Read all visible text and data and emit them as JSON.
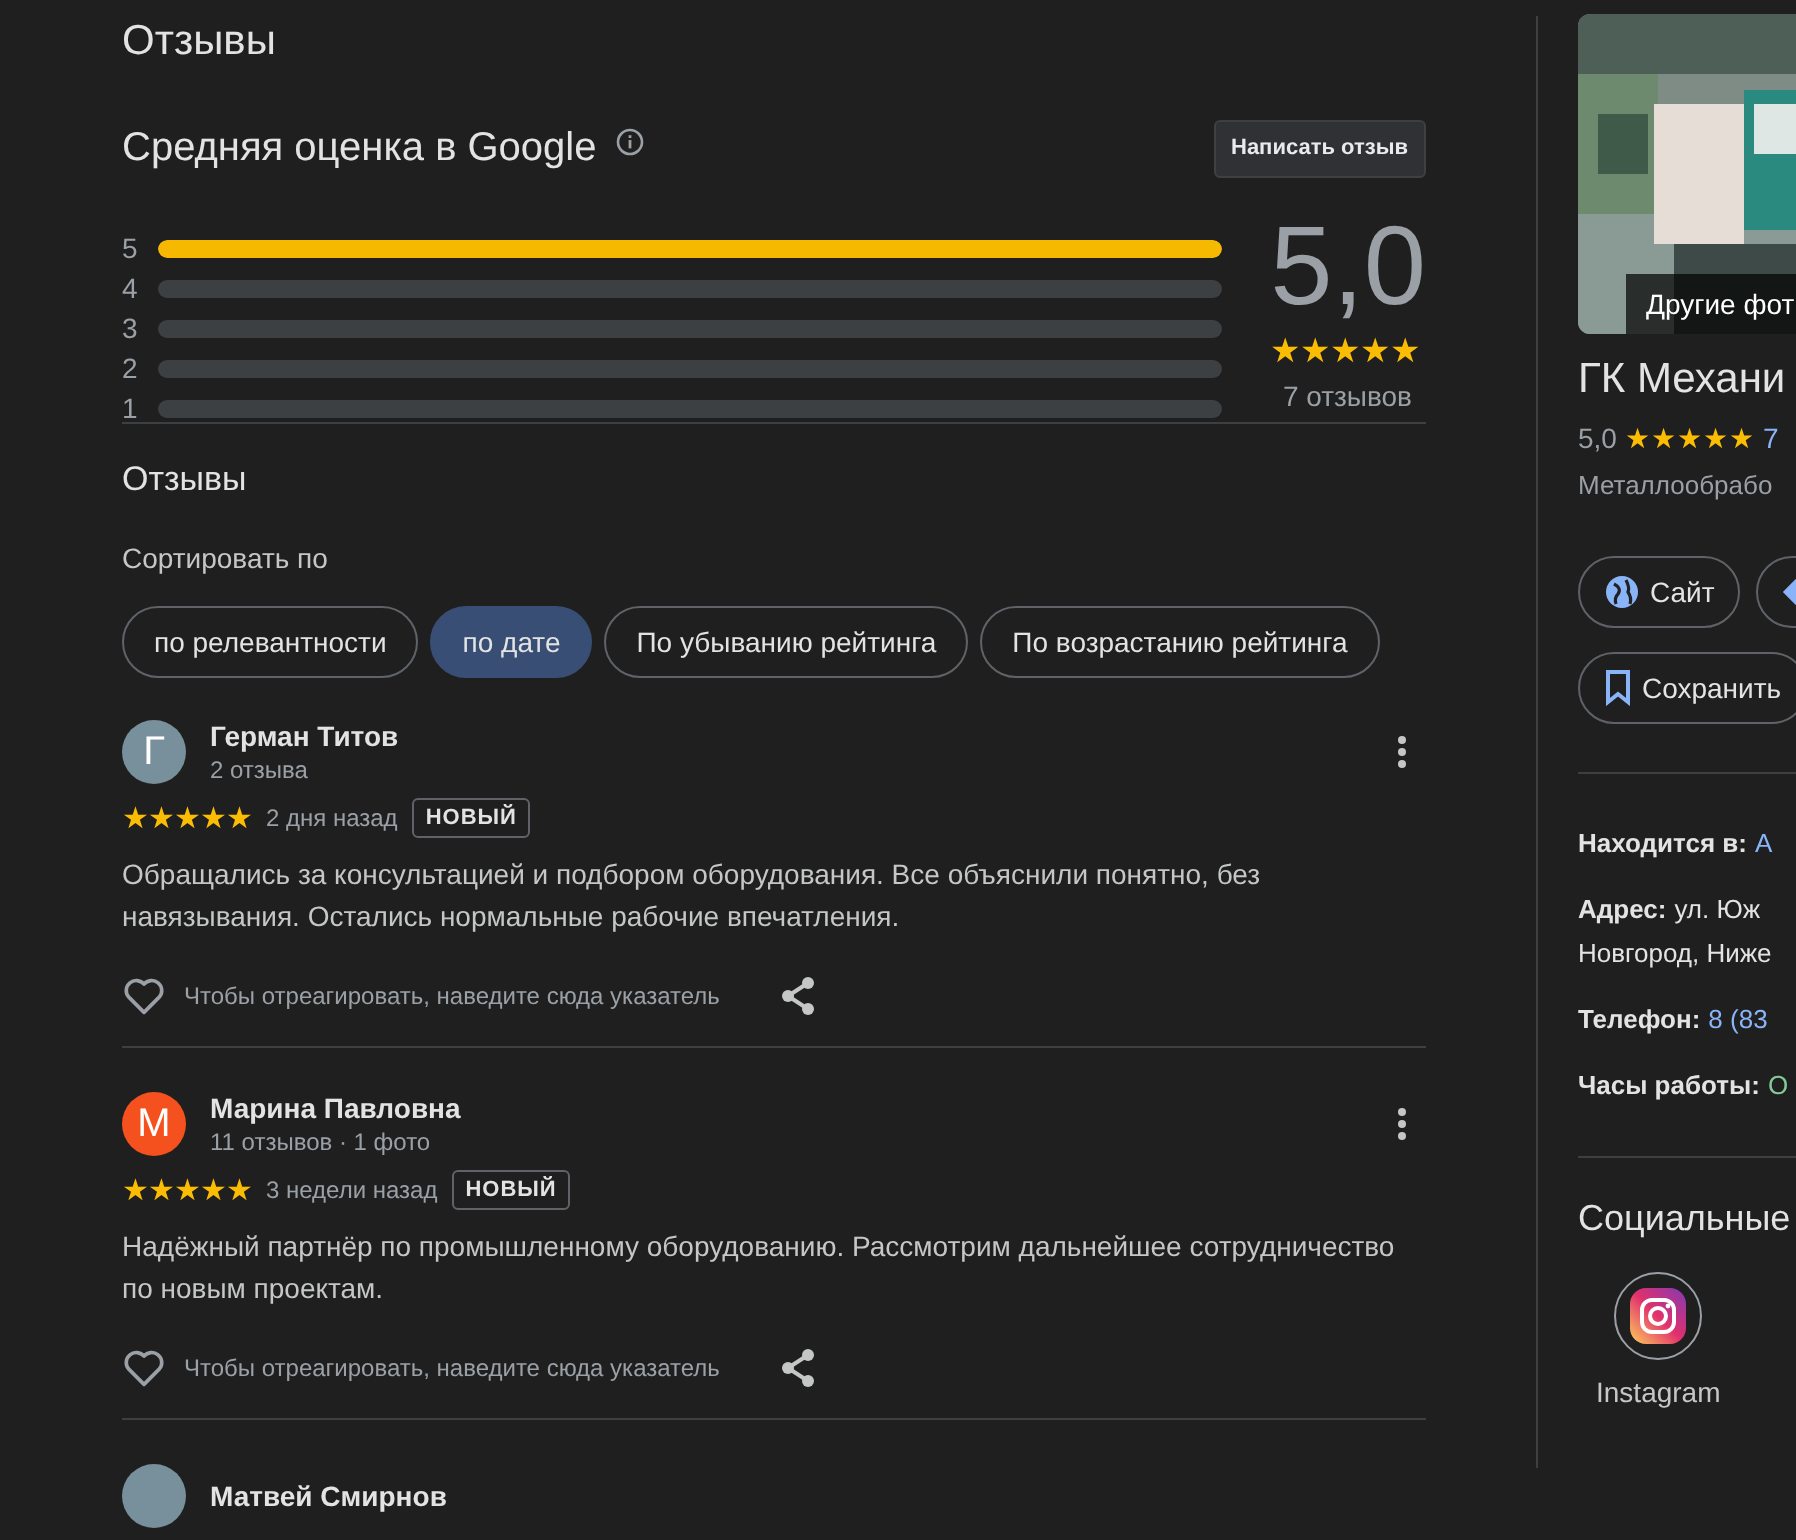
{
  "reviews_heading": "Отзывы",
  "rating_summary": {
    "title": "Средняя оценка в Google",
    "write_button": "Написать отзыв",
    "average": "5,0",
    "stars": 5,
    "count": "7 отзывов",
    "bars": [
      {
        "label": "5",
        "level": 1
      },
      {
        "label": "4",
        "level": 0
      },
      {
        "label": "3",
        "level": 0
      },
      {
        "label": "2",
        "level": 0
      },
      {
        "label": "1",
        "level": 0
      }
    ]
  },
  "reviews_subheading": "Отзывы",
  "sort_label": "Сортировать по",
  "sort_chips": [
    {
      "label": "по релевантности",
      "selected": false
    },
    {
      "label": "по дате",
      "selected": true
    },
    {
      "label": "По убыванию рейтинга",
      "selected": false
    },
    {
      "label": "По возрастанию рейтинга",
      "selected": false
    }
  ],
  "reviews": [
    {
      "initial": "Г",
      "color": "#78909c",
      "name": "Герман Титов",
      "meta": "2 отзыва",
      "stars": 5,
      "time": "2 дня назад",
      "badge": "НОВЫЙ",
      "text": "Обращались за консультацией и подбором оборудования. Все объяснили понятно, без навязывания. Остались нормальные рабочие впечатления.",
      "reaction_hint": "Чтобы отреагировать, наведите сюда указатель"
    },
    {
      "initial": "М",
      "color": "#f4511e",
      "name": "Марина Павловна",
      "meta": "11 отзывов · 1 фото",
      "stars": 5,
      "time": "3 недели назад",
      "badge": "НОВЫЙ",
      "text": "Надёжный партнёр по промышленному оборудованию. Рассмотрим дальнейшее сотрудничество по новым проектам.",
      "reaction_hint": "Чтобы отреагировать, наведите сюда указатель"
    },
    {
      "color": "#78909c",
      "name": "Матвей Смирнов"
    }
  ],
  "place": {
    "photo": {
      "kind": "picture",
      "caption": "Другие фот"
    },
    "name": "ГК Механи",
    "rating": "5,0",
    "stars": 5,
    "rating_count": "7",
    "category": "Металлообрабо",
    "actions": [
      {
        "kind": "site",
        "label": "Сайт"
      },
      {
        "kind": "directions"
      },
      {
        "kind": "save",
        "label": "Сохранить"
      }
    ],
    "info": [
      {
        "label": "Находится в:",
        "lines": [
          "А"
        ],
        "kind": "link"
      },
      {
        "label": "Адрес:",
        "lines": [
          "ул. Юж",
          "Новгород, Ниже"
        ],
        "kind": "plain"
      },
      {
        "label": "Телефон:",
        "lines": [
          "8 (83"
        ],
        "kind": "link"
      },
      {
        "label": "Часы работы:",
        "lines": [
          "О"
        ],
        "kind": "open"
      }
    ],
    "social_heading": "Социальные",
    "social": [
      {
        "label": "Instagram"
      }
    ]
  }
}
